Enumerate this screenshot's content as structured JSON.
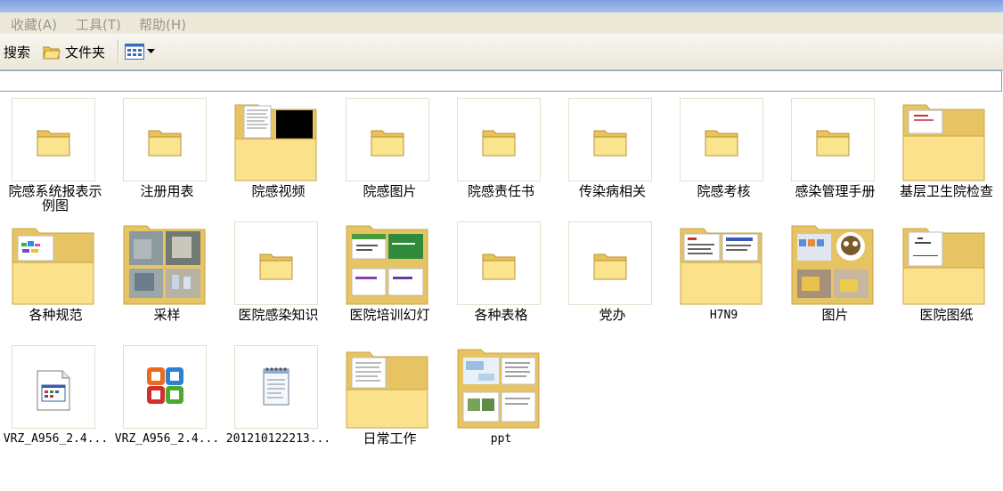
{
  "menu": {
    "favorites": "收藏(A)",
    "tools": "工具(T)",
    "help": "帮助(H)"
  },
  "toolbar": {
    "search_label": "搜索",
    "folders_label": "文件夹"
  },
  "accent": "#f5d77c",
  "items": [
    {
      "label": "院感系统报表示例图",
      "kind": "folder"
    },
    {
      "label": "注册用表",
      "kind": "folder"
    },
    {
      "label": "院感视频",
      "kind": "folder-preview"
    },
    {
      "label": "院感图片",
      "kind": "folder"
    },
    {
      "label": "院感责任书",
      "kind": "folder"
    },
    {
      "label": "传染病相关",
      "kind": "folder"
    },
    {
      "label": "院感考核",
      "kind": "folder"
    },
    {
      "label": "感染管理手册",
      "kind": "folder"
    },
    {
      "label": "基层卫生院检查",
      "kind": "folder-preview"
    },
    {
      "label": "各种规范",
      "kind": "folder-preview"
    },
    {
      "label": "采样",
      "kind": "folder-preview"
    },
    {
      "label": "医院感染知识",
      "kind": "folder"
    },
    {
      "label": "医院培训幻灯",
      "kind": "folder-preview"
    },
    {
      "label": "各种表格",
      "kind": "folder"
    },
    {
      "label": "党办",
      "kind": "folder"
    },
    {
      "label": "H7N9",
      "kind": "folder-preview"
    },
    {
      "label": "图片",
      "kind": "folder-preview"
    },
    {
      "label": "医院图纸",
      "kind": "folder-preview"
    },
    {
      "label": "VRZ_A956_2.4...",
      "kind": "file-app"
    },
    {
      "label": "VRZ_A956_2.4...",
      "kind": "file-office"
    },
    {
      "label": "201210122213...",
      "kind": "file-text"
    },
    {
      "label": "日常工作",
      "kind": "folder-preview"
    },
    {
      "label": "ppt",
      "kind": "folder-preview"
    }
  ]
}
